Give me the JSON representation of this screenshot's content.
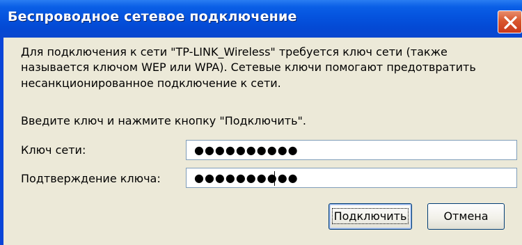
{
  "window": {
    "title": "Беспроводное сетевое подключение"
  },
  "message": {
    "line1": "Для подключения к сети \"TP-LINK_Wireless\" требуется ключ сети (также",
    "line2": "называется ключом WEP или WPA). Сетевые ключи помогают предотвратить",
    "line3": "несанкционированное подключение к сети."
  },
  "instruction": "Введите ключ и нажмите кнопку \"Подключить\".",
  "form": {
    "key_label": "Ключ сети:",
    "key_value": "●●●●●●●●●●",
    "confirm_label": "Подтверждение ключа:",
    "confirm_value": "●●●●●●●●●●"
  },
  "buttons": {
    "connect": "Подключить",
    "cancel": "Отмена"
  },
  "icons": {
    "close": "close-icon"
  },
  "colors": {
    "titlebar": "#0553de",
    "close_button": "#d9572e",
    "dialog_background": "#ece9d8",
    "field_border": "#7f9db9"
  }
}
